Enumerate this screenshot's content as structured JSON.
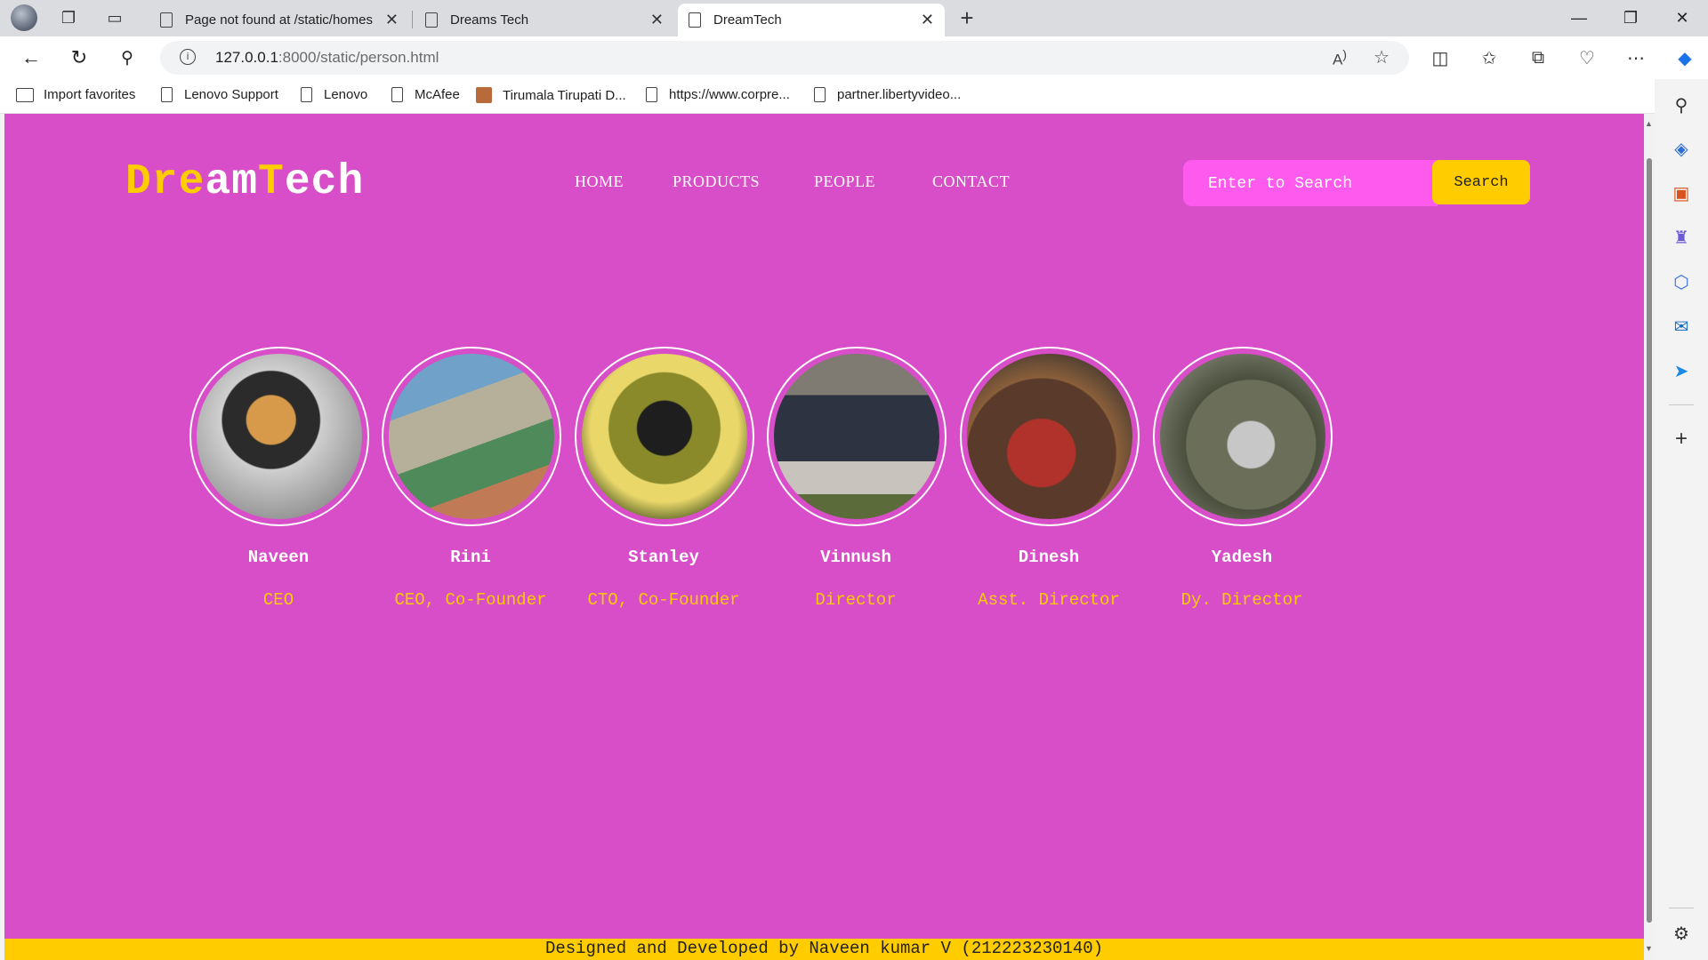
{
  "browser": {
    "tabs": [
      {
        "title": "Page not found at /static/homes",
        "active": false
      },
      {
        "title": "Dreams Tech",
        "active": false
      },
      {
        "title": "DreamTech",
        "active": true
      }
    ],
    "new_tab_label": "+",
    "address": {
      "host": "127.0.0.1",
      "path": ":8000/static/person.html"
    },
    "favorites": [
      {
        "label": "Import favorites",
        "icon": "import-icon"
      },
      {
        "label": "Lenovo Support",
        "icon": "page-icon"
      },
      {
        "label": "Lenovo",
        "icon": "page-icon"
      },
      {
        "label": "McAfee",
        "icon": "page-icon"
      },
      {
        "label": "Tirumala Tirupati D...",
        "icon": "site-favicon"
      },
      {
        "label": "https://www.corpre...",
        "icon": "page-icon"
      },
      {
        "label": "partner.libertyvideo...",
        "icon": "page-icon"
      }
    ]
  },
  "site": {
    "logo": {
      "part1": "Dre",
      "part2": "am",
      "part3": "T",
      "part4": "ech"
    },
    "nav": [
      "HOME",
      "PRODUCTS",
      "PEOPLE",
      "CONTACT"
    ],
    "search": {
      "placeholder": "Enter to Search",
      "button": "Search"
    },
    "people": [
      {
        "name": "Naveen",
        "role": "CEO"
      },
      {
        "name": "Rini",
        "role": "CEO, Co-Founder"
      },
      {
        "name": "Stanley",
        "role": "CTO, Co-Founder"
      },
      {
        "name": "Vinnush",
        "role": "Director"
      },
      {
        "name": "Dinesh",
        "role": "Asst. Director"
      },
      {
        "name": "Yadesh",
        "role": "Dy. Director"
      }
    ],
    "footer": "Designed and Developed by Naveen kumar V (212223230140)"
  },
  "colors": {
    "page_bg": "#d84ec8",
    "accent": "#ffcc00",
    "search_bg": "#ff5aee"
  }
}
